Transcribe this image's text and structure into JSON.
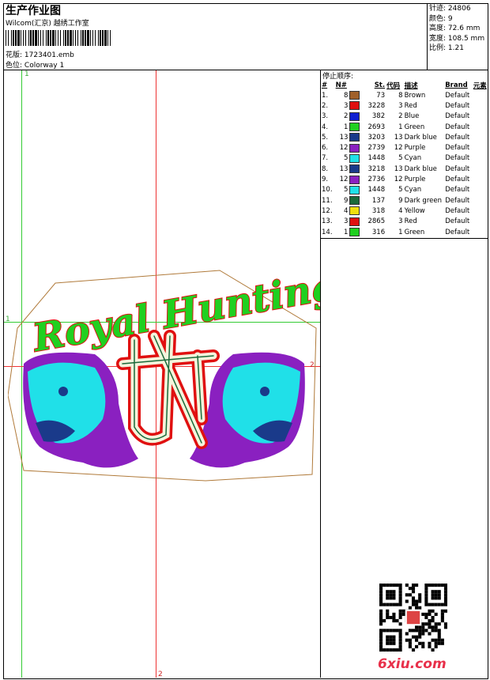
{
  "header": {
    "title": "生产作业图",
    "company": "Wilcom(汇京) 越绣工作室",
    "file_label": "花版:",
    "file_value": "1723401.emb",
    "colorway_label": "色位:",
    "colorway_value": "Colorway 1"
  },
  "stats": [
    {
      "label": "针迹:",
      "value": "24806"
    },
    {
      "label": "颜色:",
      "value": "9"
    },
    {
      "label": "高度:",
      "value": "72.6 mm"
    },
    {
      "label": "宽度:",
      "value": "108.5 mm"
    },
    {
      "label": "比例:",
      "value": "1.21"
    }
  ],
  "sequence": {
    "title": "停止顺序:",
    "headers": [
      "#",
      "N#",
      "St.",
      "代码",
      "描述",
      "Brand",
      "元素"
    ],
    "rows": [
      {
        "idx": "1.",
        "n": "8",
        "color": "#a0602a",
        "st": "73",
        "code": "8",
        "desc": "Brown",
        "brand": "Default"
      },
      {
        "idx": "2.",
        "n": "3",
        "color": "#e01010",
        "st": "3228",
        "code": "3",
        "desc": "Red",
        "brand": "Default"
      },
      {
        "idx": "3.",
        "n": "2",
        "color": "#1020d0",
        "st": "382",
        "code": "2",
        "desc": "Blue",
        "brand": "Default"
      },
      {
        "idx": "4.",
        "n": "1",
        "color": "#20d020",
        "st": "2693",
        "code": "1",
        "desc": "Green",
        "brand": "Default"
      },
      {
        "idx": "5.",
        "n": "13",
        "color": "#1a3a8a",
        "st": "3203",
        "code": "13",
        "desc": "Dark blue",
        "brand": "Default"
      },
      {
        "idx": "6.",
        "n": "12",
        "color": "#8a20c0",
        "st": "2739",
        "code": "12",
        "desc": "Purple",
        "brand": "Default"
      },
      {
        "idx": "7.",
        "n": "5",
        "color": "#20e0e8",
        "st": "1448",
        "code": "5",
        "desc": "Cyan",
        "brand": "Default"
      },
      {
        "idx": "8.",
        "n": "13",
        "color": "#1a3a8a",
        "st": "3218",
        "code": "13",
        "desc": "Dark blue",
        "brand": "Default"
      },
      {
        "idx": "9.",
        "n": "12",
        "color": "#8a20c0",
        "st": "2736",
        "code": "12",
        "desc": "Purple",
        "brand": "Default"
      },
      {
        "idx": "10.",
        "n": "5",
        "color": "#20e0e8",
        "st": "1448",
        "code": "5",
        "desc": "Cyan",
        "brand": "Default"
      },
      {
        "idx": "11.",
        "n": "9",
        "color": "#1a6a3a",
        "st": "137",
        "code": "9",
        "desc": "Dark green",
        "brand": "Default"
      },
      {
        "idx": "12.",
        "n": "4",
        "color": "#f0e010",
        "st": "318",
        "code": "4",
        "desc": "Yellow",
        "brand": "Default"
      },
      {
        "idx": "13.",
        "n": "3",
        "color": "#e01010",
        "st": "2865",
        "code": "3",
        "desc": "Red",
        "brand": "Default"
      },
      {
        "idx": "14.",
        "n": "1",
        "color": "#20d020",
        "st": "316",
        "code": "1",
        "desc": "Green",
        "brand": "Default"
      }
    ]
  },
  "design": {
    "script_text": "Royal Hunting"
  },
  "guides": {
    "v1": "1",
    "h1": "1",
    "h2": "2",
    "v2": "2"
  },
  "watermark": "6xiu.com"
}
